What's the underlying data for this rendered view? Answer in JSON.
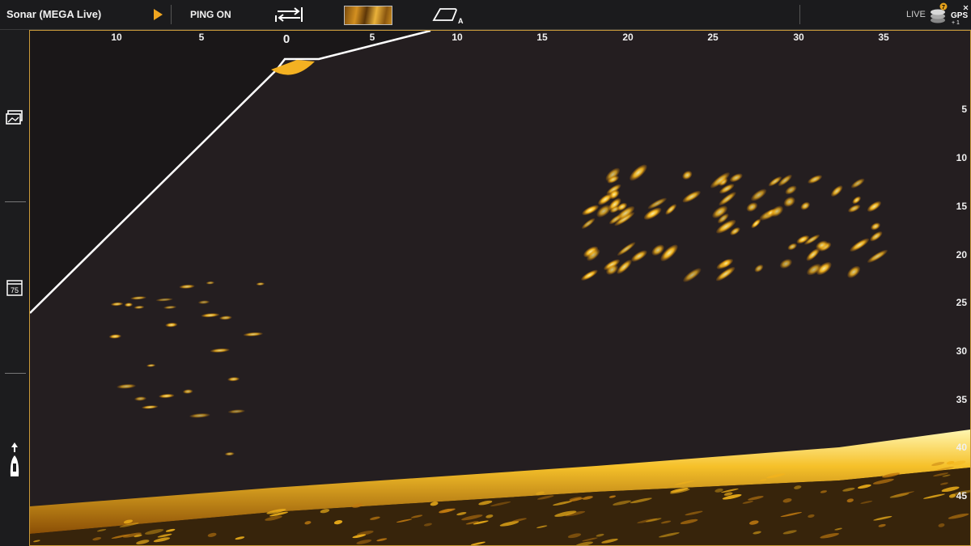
{
  "topbar": {
    "title": "Sonar (MEGA Live)",
    "play_icon": "play-icon",
    "ping_label": "PING ON",
    "swap_icon": "swap-arrows-icon",
    "palette_icon": "color-palette-swatch",
    "mode_icon": "transducer-mode-icon",
    "mode_letter": "A",
    "live_label": "LIVE",
    "layers_icon": "stacked-layers-icon",
    "layers_badge": "7",
    "gps_label": "GPS",
    "gps_sub": "+ 1"
  },
  "sidebar": {
    "image_icon": "image-gallery-icon",
    "temp_icon": "water-temperature-icon",
    "temp_value": "75",
    "boat_icon": "boat-orientation-icon"
  },
  "sonar": {
    "x_axis_left": [
      "10",
      "5"
    ],
    "x_axis_center": "0",
    "x_axis_right": [
      "5",
      "10",
      "15",
      "20",
      "25",
      "30",
      "35"
    ],
    "y_axis": [
      "5",
      "10",
      "15",
      "20",
      "25",
      "30",
      "35",
      "40",
      "45"
    ],
    "colors": {
      "background": "#241e20",
      "return_bright": "#fff2a0",
      "return_mid": "#f4b41a",
      "return_dim": "#b06a0a",
      "beam_edge": "#ffffff",
      "border": "#c99a3a"
    }
  }
}
